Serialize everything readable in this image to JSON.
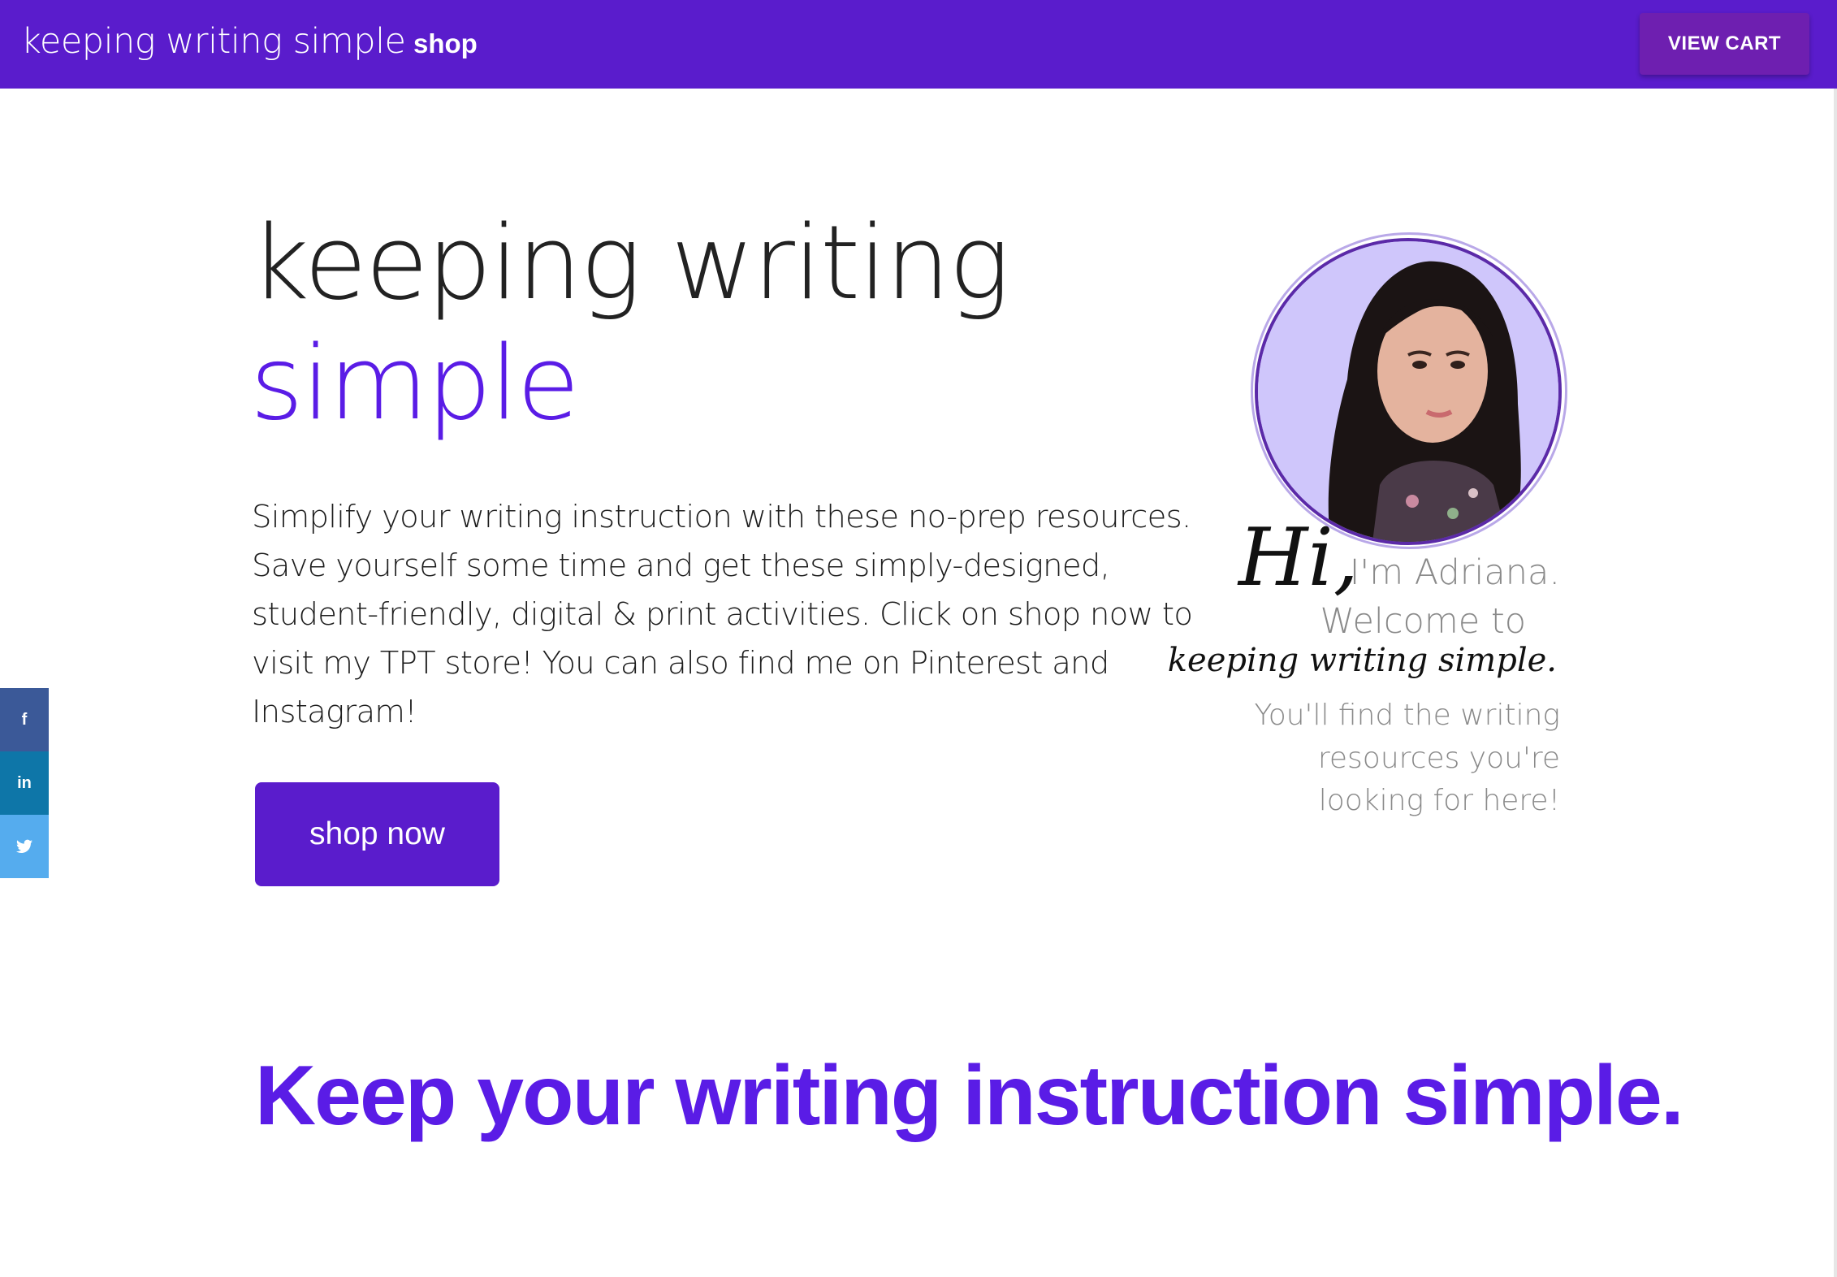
{
  "header": {
    "brand": "keeping writing simple",
    "nav_shop": "shop",
    "cart_button": "VIEW CART"
  },
  "hero": {
    "title_line1": "keeping writing",
    "title_line2": "simple",
    "intro": "Simplify your writing instruction with these no-prep resources. Save yourself some time and get these simply-designed, student-friendly, digital & print activities. Click on shop now to visit my TPT store! You can also find me on Pinterest and Instagram!",
    "cta": "shop now"
  },
  "greeting": {
    "hi": "Hi,",
    "line1": "I'm Adriana.",
    "line2": "Welcome to",
    "line3": "keeping writing simple.",
    "line4": "You'll find the writing",
    "line5": "resources you're",
    "line6": "looking for here!"
  },
  "social": {
    "facebook": "f",
    "linkedin": "in",
    "twitter": "t"
  },
  "section": {
    "tagline": "Keep your writing instruction simple."
  },
  "colors": {
    "brand_purple": "#5a1ccc",
    "accent_purple": "#5a1ce6",
    "cart_purple": "#6e1fb0",
    "facebook": "#3b5998",
    "linkedin": "#0e76a8",
    "twitter": "#55acee",
    "portrait_bg": "#cfc6fb"
  },
  "icons": {
    "facebook": "facebook-icon",
    "linkedin": "linkedin-icon",
    "twitter": "twitter-icon"
  }
}
